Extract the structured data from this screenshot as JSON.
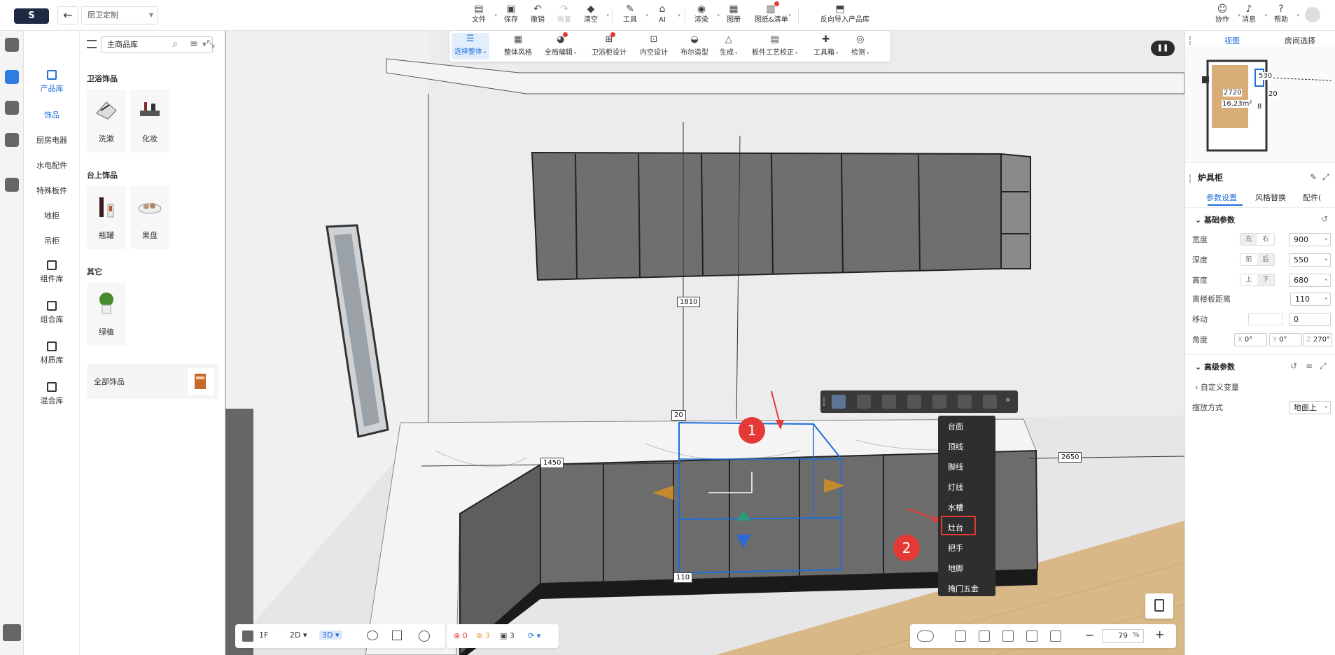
{
  "topbar": {
    "logo": "S",
    "project_name": "厨卫定制",
    "items": [
      {
        "label": "文件",
        "icon": "file-icon"
      },
      {
        "label": "保存",
        "icon": "save-icon"
      },
      {
        "label": "撤销",
        "icon": "undo-icon"
      },
      {
        "label": "恢复",
        "icon": "redo-icon"
      },
      {
        "label": "清空",
        "icon": "eraser-icon"
      },
      {
        "label": "工具",
        "icon": "wrench-icon"
      },
      {
        "label": "AI",
        "icon": "ai-icon"
      },
      {
        "label": "渲染",
        "icon": "render-icon"
      },
      {
        "label": "图册",
        "icon": "album-icon"
      },
      {
        "label": "图纸&清单",
        "icon": "drawings-icon"
      },
      {
        "label": "反向导入产品库",
        "icon": "import-icon"
      }
    ],
    "right_items": [
      {
        "label": "协作",
        "icon": "collab-icon"
      },
      {
        "label": "消息",
        "icon": "bell-icon"
      },
      {
        "label": "帮助",
        "icon": "help-icon"
      }
    ]
  },
  "categories": {
    "main": {
      "label": "产品库",
      "icon": "product-library-icon"
    },
    "subcats": [
      "饰品",
      "厨房电器",
      "水电配件",
      "特殊板件",
      "地柜",
      "吊柜"
    ],
    "libs": [
      {
        "label": "组件库",
        "icon": "component-icon"
      },
      {
        "label": "组合库",
        "icon": "combination-icon"
      },
      {
        "label": "材质库",
        "icon": "material-icon"
      },
      {
        "label": "混合库",
        "icon": "mixed-icon"
      }
    ]
  },
  "library": {
    "selector": "主商品库",
    "groups": [
      {
        "title": "卫浴饰品",
        "items": [
          "洗漱",
          "化妆"
        ]
      },
      {
        "title": "台上饰品",
        "items": [
          "瓶罐",
          "果盘"
        ]
      },
      {
        "title": "其它",
        "items": [
          "绿植"
        ]
      }
    ],
    "all_label": "全部饰品"
  },
  "tool_panel": {
    "items": [
      {
        "label": "选择整体",
        "icon": "select-all-icon"
      },
      {
        "label": "整体风格",
        "icon": "style-icon"
      },
      {
        "label": "全局编辑",
        "icon": "global-edit-icon"
      },
      {
        "label": "卫浴柜设计",
        "icon": "bath-cabinet-icon"
      },
      {
        "label": "内空设计",
        "icon": "interior-icon"
      },
      {
        "label": "布尔造型",
        "icon": "boolean-icon"
      },
      {
        "label": "生成",
        "icon": "generate-icon"
      },
      {
        "label": "板件工艺校正",
        "icon": "board-craft-icon"
      },
      {
        "label": "工具箱",
        "icon": "toolbox-icon"
      },
      {
        "label": "检测",
        "icon": "check-icon"
      }
    ]
  },
  "viewport": {
    "dims": {
      "d1810": "1810",
      "d20": "20",
      "d1450": "1450",
      "d2650": "2650",
      "d110": "110"
    },
    "context_menu": [
      "台面",
      "顶线",
      "脚线",
      "灯线",
      "水槽",
      "灶台",
      "把手",
      "地脚",
      "掩门五金"
    ],
    "highlighted": "灶台",
    "badges": [
      "1",
      "2"
    ]
  },
  "right_panel": {
    "tabs": [
      "视图",
      "房间选择"
    ],
    "minimap": {
      "w": "2720",
      "area": "16.23m²",
      "n530": "530",
      "n20": "20",
      "n8": "8"
    },
    "object_title": "炉具柜",
    "sub_tabs": [
      "参数设置",
      "风格替换",
      "配件("
    ],
    "basic_title": "基础参数",
    "params": [
      {
        "label": "宽度",
        "a": "左",
        "b": "右",
        "value": "900"
      },
      {
        "label": "深度",
        "a": "前",
        "b": "后",
        "value": "550"
      },
      {
        "label": "高度",
        "a": "上",
        "b": "下",
        "value": "680"
      }
    ],
    "floor_dist": {
      "label": "离楼板距离",
      "value": "110"
    },
    "move": {
      "label": "移动",
      "value": "0"
    },
    "angle": {
      "label": "角度",
      "x": "0°",
      "y": "0°",
      "z": "270°"
    },
    "advanced_title": "高级参数",
    "custom_var": "自定义变量",
    "placement": {
      "label": "摆放方式",
      "value": "地面上"
    }
  },
  "bottom": {
    "floor": "1F",
    "mode_2d": "2D",
    "mode_3d": "3D",
    "errors": "0",
    "warnings": "3",
    "infos": "3",
    "zoom": "79",
    "zoom_unit": "%"
  }
}
